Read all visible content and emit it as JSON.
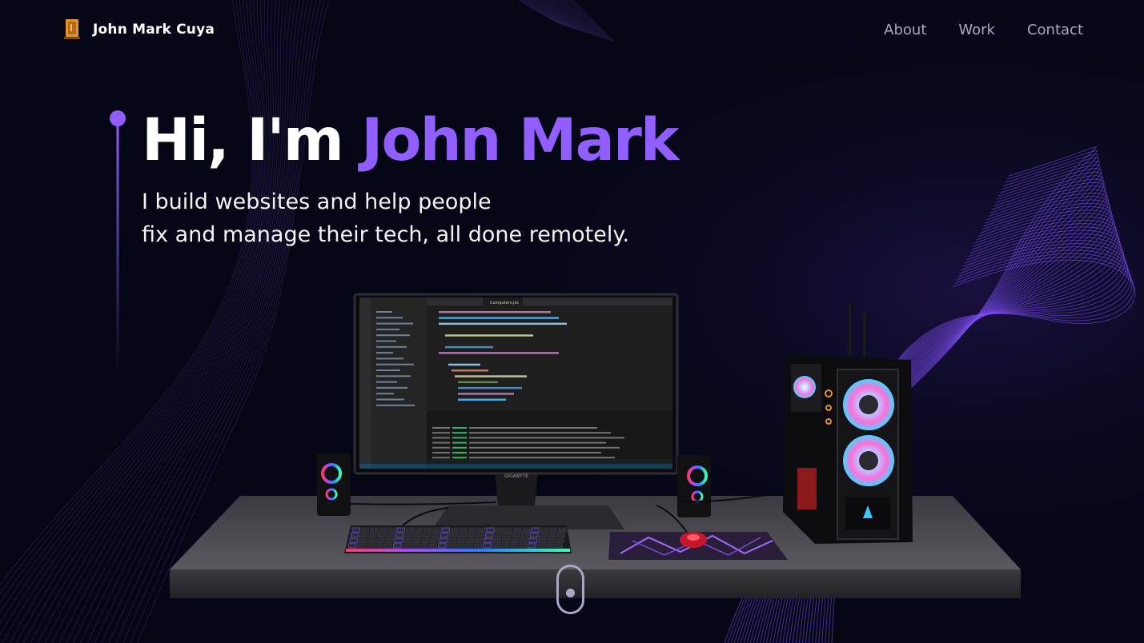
{
  "nav": {
    "brand_name": "John Mark  Cuya",
    "links": [
      {
        "label": "About"
      },
      {
        "label": "Work"
      },
      {
        "label": "Contact"
      }
    ]
  },
  "hero": {
    "greeting": "Hi, I'm ",
    "name": "John Mark",
    "subtitle_line1": "I build websites and help people",
    "subtitle_line2": "fix and manage their tech, all done remotely."
  },
  "scene": {
    "monitor_brand": "GIGABYTE",
    "editor_tab_active": "Computers.jsx"
  },
  "colors": {
    "background": "#050716",
    "accent": "#915eff",
    "secondary_text": "#aaa6c3"
  },
  "icons": {
    "logo": "laptop-logo-icon",
    "scroll": "scroll-down-icon"
  }
}
